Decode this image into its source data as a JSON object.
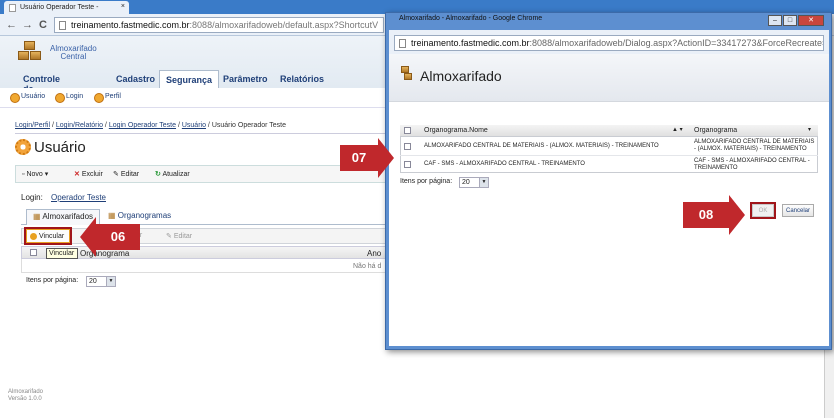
{
  "browser": {
    "tab_title": "Usuário Operador Teste -",
    "tab_close": "×",
    "url_host": "treinamento.fastmedic.com.br",
    "url_rest": ":8088/almoxarifadoweb/default.aspx?ShortcutV",
    "back": "←",
    "forward": "→",
    "reload": "C"
  },
  "app": {
    "brand_line1": "Almoxarifado",
    "brand_line2": "Central",
    "menu": [
      "Controle de Estoque",
      "Cadastro",
      "Segurança",
      "Parâmetro",
      "Relatórios"
    ],
    "submenu": [
      "Usuário",
      "Login",
      "Perfil"
    ],
    "breadcrumb": [
      "Login/Perfil",
      "Login/Relatório",
      "Login Operador Teste",
      "Usuário",
      "Usuário Operador Teste"
    ],
    "page_title": "Usuário",
    "toolbar": {
      "novo": "Novo",
      "excluir": "Excluir",
      "editar": "Editar",
      "atualizar": "Atualizar"
    },
    "login_label": "Login:",
    "login_value": "Operador Teste",
    "tabs": [
      "Almoxarifados",
      "Organogramas"
    ],
    "grid_toolbar": {
      "vincular": "Vincular",
      "desvincular": "cular",
      "editar": "Editar"
    },
    "tooltip": "Vincular",
    "grid_header": {
      "col1": "Organograma",
      "col2": "Ano"
    },
    "grid_empty": "Não há d",
    "items_per_page_label": "Itens por página:",
    "items_per_page_value": "20",
    "footer_line1": "Almoxarifado",
    "footer_line2": "Versão 1.0.0"
  },
  "dialog": {
    "window_title": "Almoxarifado - Almoxarifado - Google Chrome",
    "url_host": "treinamento.fastmedic.com.br",
    "url_rest": ":8088/almoxarifadoweb/Dialog.aspx?ActionID=33417273&ForceRecreate=",
    "heading": "Almoxarifado",
    "columns": [
      "Organograma.Nome",
      "Organograma"
    ],
    "rows": [
      {
        "nome": "ALMOXARIFADO CENTRAL DE MATERIAIS - (ALMOX. MATERIAIS) - TREINAMENTO",
        "organograma": "ALMOXARIFADO CENTRAL DE MATERIAIS - (ALMOX. MATERIAIS) - TREINAMENTO"
      },
      {
        "nome": "CAF - SMS - ALMOXARIFADO CENTRAL - TREINAMENTO",
        "organograma": "CAF - SMS - ALMOXARIFADO CENTRAL - TREINAMENTO"
      }
    ],
    "items_per_page_label": "Itens por página:",
    "items_per_page_value": "20",
    "ok": "OK",
    "cancel": "Cancelar"
  },
  "callouts": {
    "step06": "06",
    "step07": "07",
    "step08": "08"
  },
  "colors": {
    "callout": "#c0282c",
    "chrome_frame": "#5d8fd0",
    "link": "#1f3f78"
  }
}
